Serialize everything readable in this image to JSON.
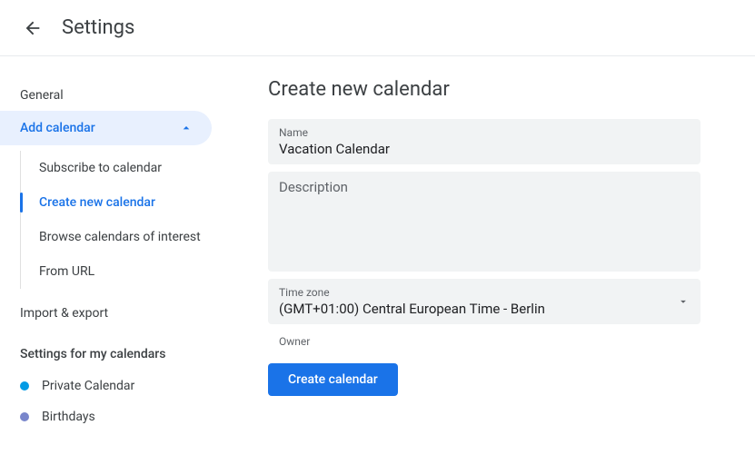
{
  "header": {
    "title": "Settings"
  },
  "sidebar": {
    "general": "General",
    "add_calendar": "Add calendar",
    "sub": {
      "subscribe": "Subscribe to calendar",
      "create": "Create new calendar",
      "browse": "Browse calendars of interest",
      "from_url": "From URL"
    },
    "import_export": "Import & export",
    "my_cals_heading": "Settings for my calendars",
    "cals": [
      {
        "label": "Private Calendar",
        "color": "#039be5"
      },
      {
        "label": "Birthdays",
        "color": "#7986cb"
      }
    ]
  },
  "main": {
    "heading": "Create new calendar",
    "name_label": "Name",
    "name_value": "Vacation Calendar",
    "desc_label": "Description",
    "desc_value": "",
    "tz_label": "Time zone",
    "tz_value": "(GMT+01:00) Central European Time - Berlin",
    "owner_label": "Owner",
    "owner_value": "",
    "create_btn": "Create calendar"
  }
}
